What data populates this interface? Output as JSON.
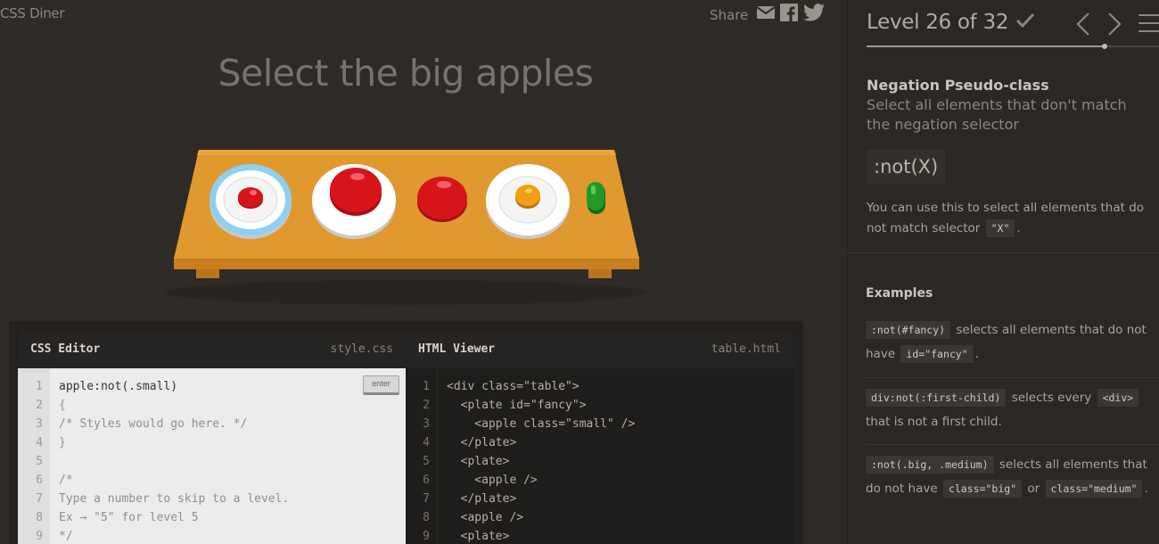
{
  "app": {
    "logo": "CSS Diner"
  },
  "share": {
    "label": "Share",
    "icons": [
      "mail-icon",
      "facebook-icon",
      "twitter-icon"
    ]
  },
  "order": "Select the big apples",
  "css_editor": {
    "title": "CSS Editor",
    "file": "style.css",
    "enter_label": "enter",
    "line_numbers": [
      "1",
      "2",
      "3",
      "4",
      "5",
      "6",
      "7",
      "8",
      "9"
    ],
    "lines": [
      "apple:not(.small)",
      "{",
      "/* Styles would go here. */",
      "}",
      "",
      "/*",
      "Type a number to skip to a level.",
      "Ex → \"5\" for level 5",
      "*/"
    ]
  },
  "html_viewer": {
    "title": "HTML Viewer",
    "file": "table.html",
    "line_numbers": [
      "1",
      "2",
      "3",
      "4",
      "5",
      "6",
      "7",
      "8",
      "9"
    ],
    "lines": [
      "<div class=\"table\">",
      "  <plate id=\"fancy\">",
      "    <apple class=\"small\" />",
      "  </plate>",
      "  <plate>",
      "    <apple />",
      "  </plate>",
      "  <apple />",
      "  <plate>"
    ]
  },
  "level": {
    "text": "Level 26 of 32",
    "current": 26,
    "total": 32,
    "completed": true,
    "progress": 0.8125
  },
  "instructions": {
    "selector_name": "Negation Pseudo-class",
    "title": "Select all elements that don't match the negation selector",
    "syntax": ":not(X)",
    "hint_before": "You can use this to select all elements that do not match selector",
    "hint_code": "\"X\"",
    "hint_after": "."
  },
  "examples": {
    "title": "Examples",
    "items": [
      {
        "code1": ":not(#fancy)",
        "text1": "selects all elements that do not have",
        "code2": "id=\"fancy\"",
        "text2": ".",
        "code3": "",
        "text3": ""
      },
      {
        "code1": "div:not(:first-child)",
        "text1": "selects every",
        "code2": "<div>",
        "text2": "that is not a first child.",
        "code3": "",
        "text3": ""
      },
      {
        "code1": ":not(.big, .medium)",
        "text1": "selects all elements that do not have",
        "code2": "class=\"big\"",
        "text2": "or",
        "code3": "class=\"medium\"",
        "text3": "."
      }
    ]
  },
  "colors": {
    "background": "#2e2a26",
    "table": "#e0992f",
    "apple_red": "#d8141b",
    "orange": "#f0a010",
    "pickle": "#1f9a2a",
    "fancy_plate_ring": "#8fd0f0"
  }
}
